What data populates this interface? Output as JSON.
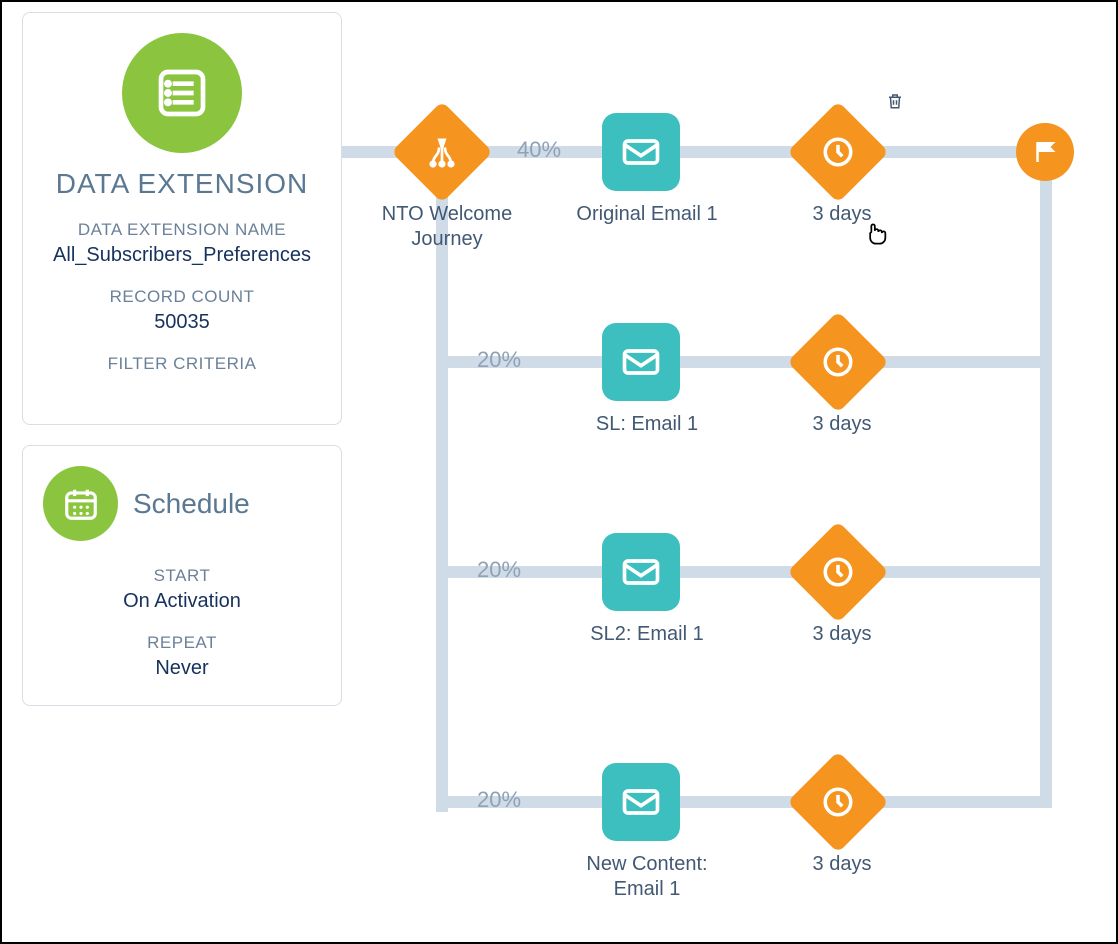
{
  "data_extension": {
    "title": "DATA EXTENSION",
    "name_label": "DATA EXTENSION NAME",
    "name_value": "All_Subscribers_Preferences",
    "record_count_label": "RECORD COUNT",
    "record_count_value": "50035",
    "filter_criteria_label": "FILTER CRITERIA"
  },
  "schedule": {
    "title": "Schedule",
    "start_label": "START",
    "start_value": "On Activation",
    "repeat_label": "REPEAT",
    "repeat_value": "Never"
  },
  "journey": {
    "split_name": "NTO Welcome Journey",
    "branches": [
      {
        "percent": "40%",
        "email_label": "Original Email 1",
        "wait_label": "3 days"
      },
      {
        "percent": "20%",
        "email_label": "SL: Email 1",
        "wait_label": "3 days"
      },
      {
        "percent": "20%",
        "email_label": "SL2: Email 1",
        "wait_label": "3 days"
      },
      {
        "percent": "20%",
        "email_label": "New Content: Email 1",
        "wait_label": "3 days"
      }
    ]
  },
  "colors": {
    "green": "#8bc53f",
    "teal": "#3dbfbf",
    "orange": "#f5941e",
    "connector": "#cfdce8"
  }
}
